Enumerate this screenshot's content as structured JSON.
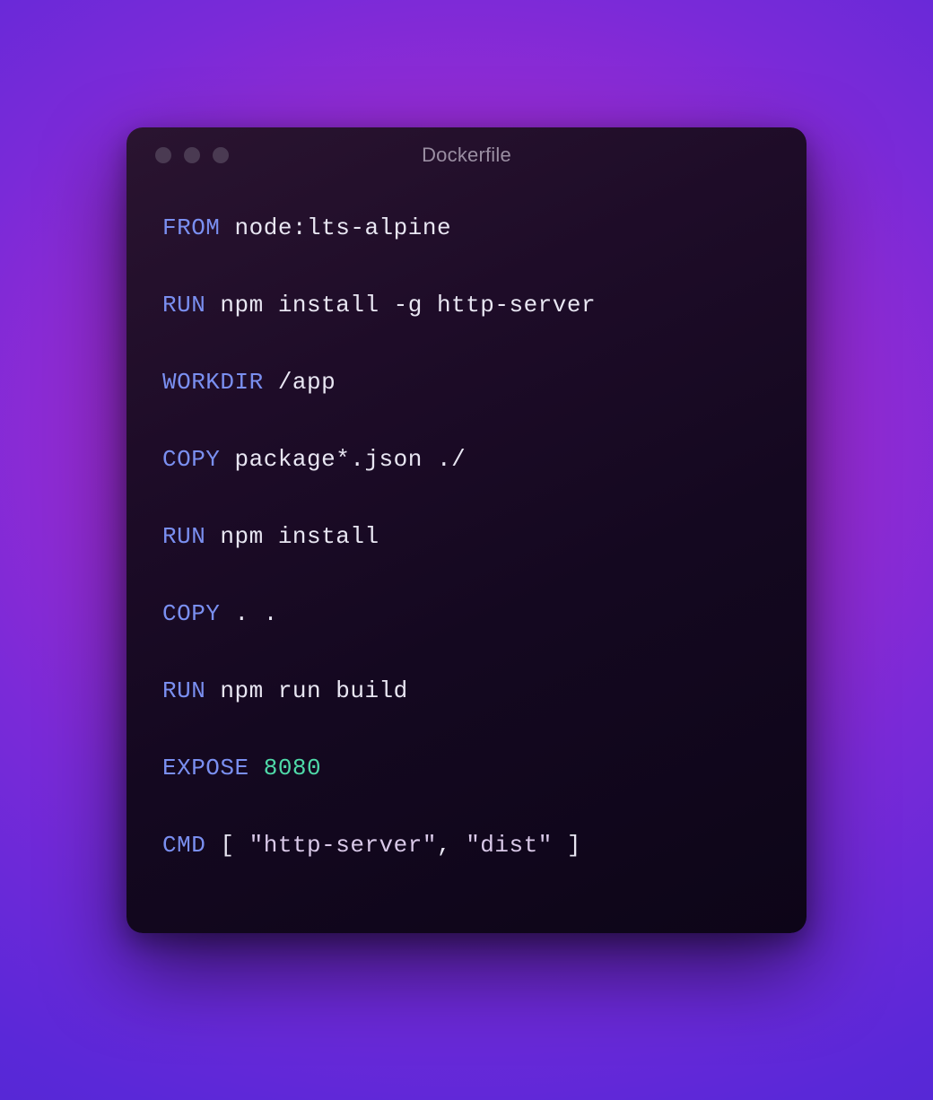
{
  "window": {
    "title": "Dockerfile"
  },
  "code": {
    "lines": [
      {
        "kw": "FROM",
        "rest": " node:lts-alpine"
      },
      {
        "kw": "RUN",
        "rest": " npm install -g http-server"
      },
      {
        "kw": "WORKDIR",
        "rest": " /app"
      },
      {
        "kw": "COPY",
        "rest": " package*.json ./"
      },
      {
        "kw": "RUN",
        "rest": " npm install"
      },
      {
        "kw": "COPY",
        "rest": " . ."
      },
      {
        "kw": "RUN",
        "rest": " npm run build"
      },
      {
        "kw": "EXPOSE",
        "num": " 8080"
      },
      {
        "kw": "CMD",
        "punc0": " [ ",
        "str0": "\"http-server\"",
        "punc1": ", ",
        "str1": "\"dist\"",
        "punc2": " ]"
      }
    ]
  }
}
